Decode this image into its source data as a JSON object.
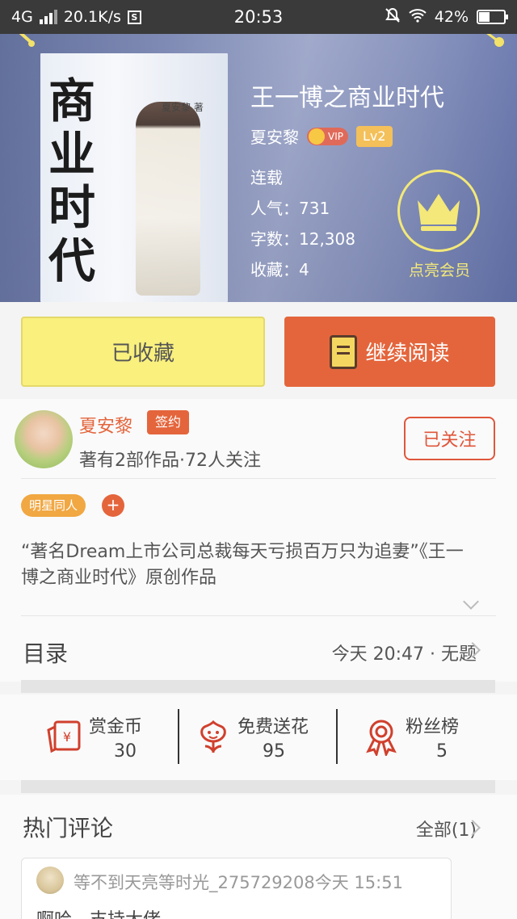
{
  "status_bar": {
    "network": "4G",
    "speed": "20.1K/s",
    "time": "20:53",
    "battery": "42%"
  },
  "book": {
    "cover_title_chars": [
      "商",
      "业",
      "时",
      "代"
    ],
    "cover_byline": "夏安黎 著",
    "title": "王一博之商业时代",
    "author": "夏安黎",
    "vip": "VIP",
    "level": "Lv2",
    "status": "连载",
    "popularity": "人气：731",
    "word_count": "字数：12,308",
    "favorites": "收藏：4",
    "member_label": "点亮会员"
  },
  "actions": {
    "collected_label": "已收藏",
    "continue_label": "继续阅读"
  },
  "author": {
    "name": "夏安黎",
    "signed_badge": "签约",
    "meta": "著有2部作品·72人关注",
    "follow_label": "已关注"
  },
  "genre_tag": "明星同人",
  "add_tag": "+",
  "description": "“著名Dream上市公司总裁每天亏损百万只为追妻”《王一博之商业时代》原创作品",
  "toc": {
    "title": "目录",
    "latest": "今天 20:47 · 无题"
  },
  "stats": [
    {
      "label": "赏金币",
      "value": "30",
      "icon": "coin-envelope-icon"
    },
    {
      "label": "免费送花",
      "value": "95",
      "icon": "flower-icon"
    },
    {
      "label": "粉丝榜",
      "value": "5",
      "icon": "ribbon-medal-icon"
    }
  ],
  "comments": {
    "title": "热门评论",
    "all_label": "全部(1)",
    "items": [
      {
        "user": "等不到天亮等时光_275729208",
        "time": "今天 15:51",
        "text": "啊哈，支持大佬"
      }
    ]
  },
  "colors": {
    "accent_orange": "#e4653c",
    "collect_yellow": "#f9f07e",
    "member_yellow": "#f3e879"
  }
}
